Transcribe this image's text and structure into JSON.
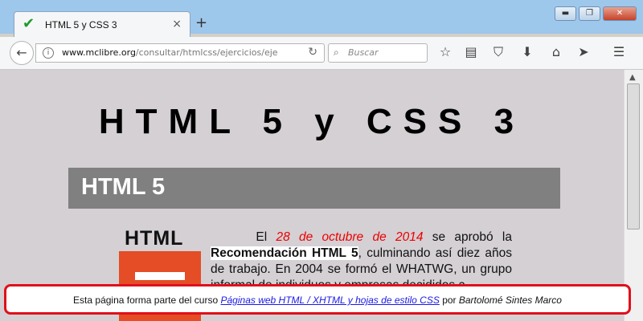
{
  "browser": {
    "tab_title": "HTML 5 y CSS 3",
    "tab_close": "×",
    "new_tab": "+",
    "window_buttons": {
      "minimize": "▬",
      "maximize": "❐",
      "close": "✕"
    },
    "url_domain": "www.mclibre.org",
    "url_path": "/consultar/htmlcss/ejercicios/eje",
    "search_placeholder": "Buscar",
    "icons": [
      "back-icon",
      "info-icon",
      "reload-icon",
      "search-icon",
      "bookmark-star-icon",
      "reading-list-icon",
      "pocket-icon",
      "download-icon",
      "home-icon",
      "send-icon",
      "menu-icon"
    ]
  },
  "page": {
    "title": "HTML 5 y CSS 3",
    "section_heading": "HTML 5",
    "logo_text": "HTML",
    "paragraph": {
      "lead": "El",
      "date": "28 de octubre de 2014",
      "mid": "se aprobó la",
      "strong": "Recomendación HTML 5",
      "rest": ", culminando así diez años de trabajo. En 2004 se formó el WHATWG, un grupo informal de individuos y empresas decididos a"
    }
  },
  "footer": {
    "prefix": "Esta página forma parte del curso",
    "link": "Páginas web HTML / XHTML y hojas de estilo CSS",
    "by": "por",
    "author": "Bartolomé Sintes Marco"
  },
  "colors": {
    "highlight_border": "#e0101a",
    "date_red": "#e00000",
    "section_bg": "#808080"
  }
}
